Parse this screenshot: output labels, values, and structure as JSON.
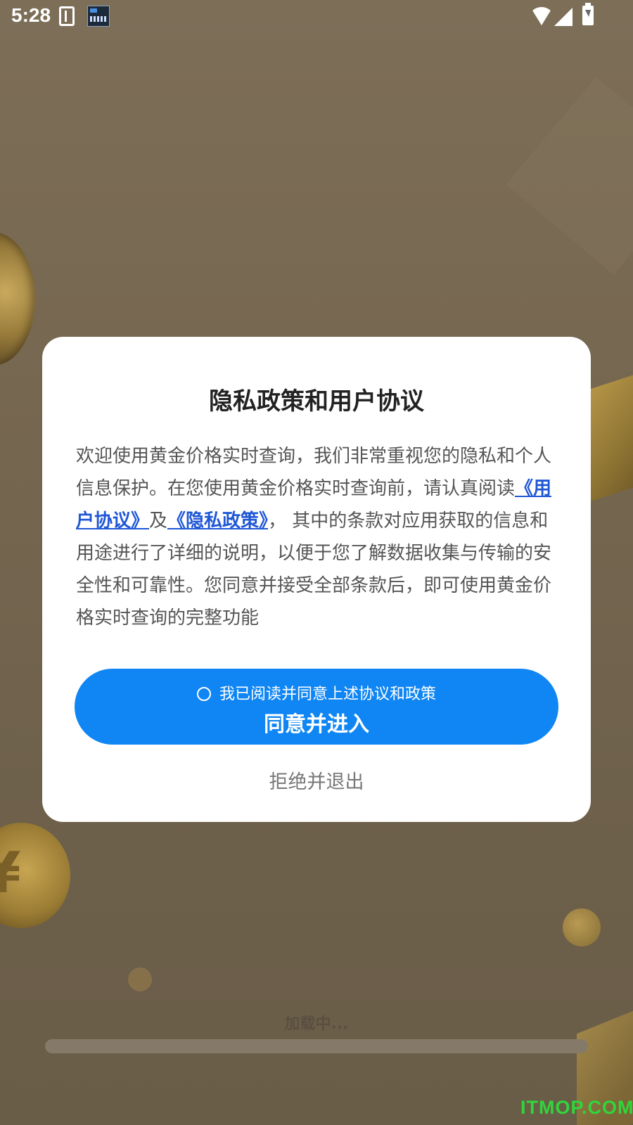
{
  "status_bar": {
    "time": "5:28",
    "icons": [
      "sim-card-icon",
      "notification-app-icon",
      "wifi-icon",
      "signal-icon",
      "battery-charging-icon"
    ]
  },
  "dialog": {
    "title": "隐私政策和用户协议",
    "body_intro": "欢迎使用黄金价格实时查询，我们非常重视您的隐私和个人信息保护。在您使用黄金价格实时查询前，请认真阅读",
    "user_agreement_link": "《用户协议》",
    "and_text": "及",
    "privacy_policy_link": "《隐私政策》",
    "body_rest": "， 其中的条款对应用获取的信息和用途进行了详细的说明，以便于您了解数据收集与传输的安全性和可靠性。您同意并接受全部条款后，即可使用黄金价格实时查询的完整功能",
    "agree_checkbox_label": "我已阅读并同意上述协议和政策",
    "agree_checked": false,
    "agree_button_label": "同意并进入",
    "reject_button_label": "拒绝并退出"
  },
  "loading": {
    "text": "加载中..."
  },
  "watermark": "ITMOP.COM",
  "colors": {
    "primary_button": "#0f86f4",
    "link": "#1f57d6",
    "dialog_background": "#ffffff",
    "overlay_background": "#75664f"
  }
}
